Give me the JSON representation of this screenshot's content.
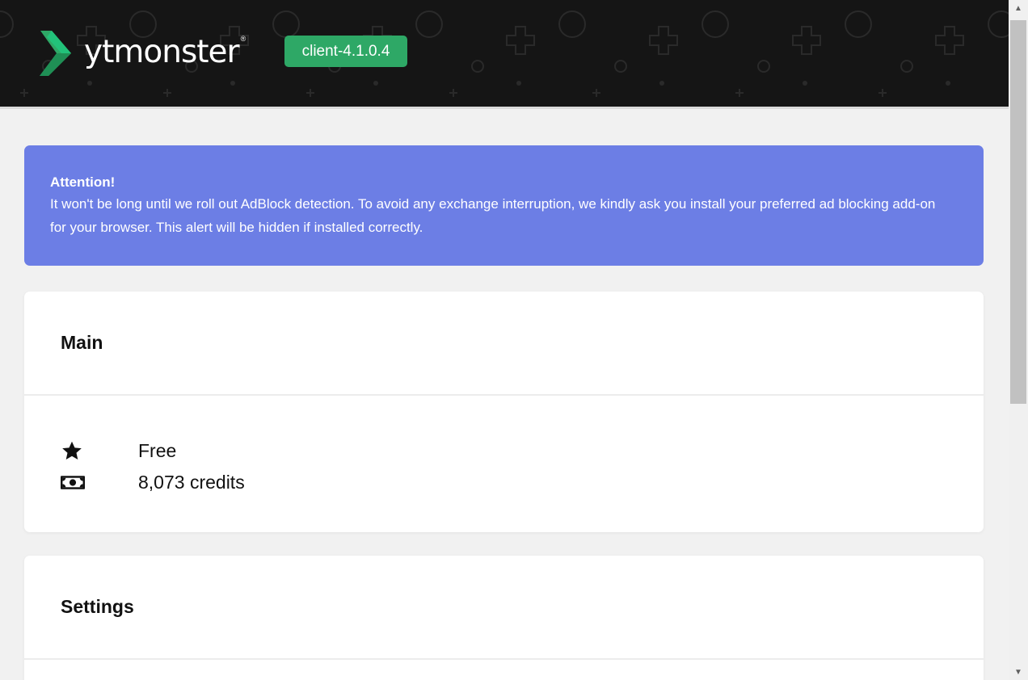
{
  "header": {
    "logo_text": "ytmonster",
    "logo_reg": "®",
    "version_badge": "client-4.1.0.4",
    "brand_color": "#2ea866",
    "background_color": "#151515"
  },
  "alert": {
    "title": "Attention!",
    "line1": "It won't be long until we roll out AdBlock detection. To avoid any exchange interruption, we kindly ask you install your preferred ad blocking add-on",
    "line2": "for your browser. This alert will be hidden if installed correctly.",
    "background_color": "#6c7ee5"
  },
  "main_card": {
    "title": "Main",
    "rows": [
      {
        "icon": "star-icon",
        "value": "Free"
      },
      {
        "icon": "money-bill-icon",
        "value": "8,073 credits"
      }
    ]
  },
  "settings_card": {
    "title": "Settings"
  }
}
